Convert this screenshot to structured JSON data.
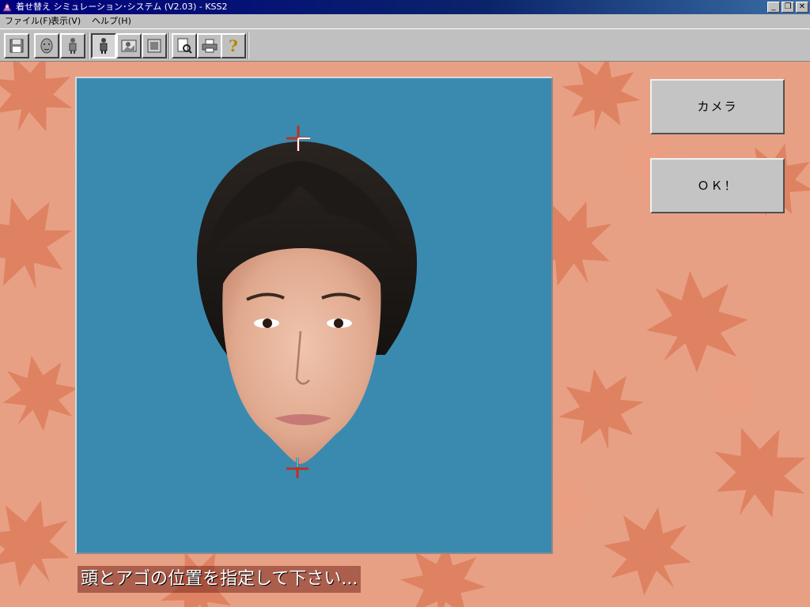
{
  "window": {
    "title": "着せ替え シミュレーション･システム (V2.03) - KSS2",
    "controls": {
      "minimize": "_",
      "restore": "❐",
      "close": "✕"
    }
  },
  "menu": {
    "items": [
      {
        "label": "ファイル(F)"
      },
      {
        "label": "表示(V)"
      },
      {
        "label": "ヘルプ(H)"
      }
    ]
  },
  "toolbar": {
    "buttons": [
      {
        "icon": "floppy-save-icon"
      },
      {
        "icon": "face-front-icon"
      },
      {
        "icon": "person-standing-icon"
      },
      {
        "icon": "person-selected-icon",
        "pressed": true
      },
      {
        "icon": "photo-frame-icon"
      },
      {
        "icon": "film-icon"
      },
      {
        "icon": "document-search-icon"
      },
      {
        "icon": "printer-icon"
      },
      {
        "icon": "help-question-icon",
        "glyph": "?"
      }
    ]
  },
  "side_buttons": {
    "camera_label": "カメラ",
    "ok_label": "ＯＫ！"
  },
  "instruction": {
    "text": "頭とアゴの位置を指定して下さい..."
  },
  "colors": {
    "photo_background": "#3a8ab0",
    "wallpaper": "#e8a085",
    "crosshair_red": "#c03020"
  }
}
